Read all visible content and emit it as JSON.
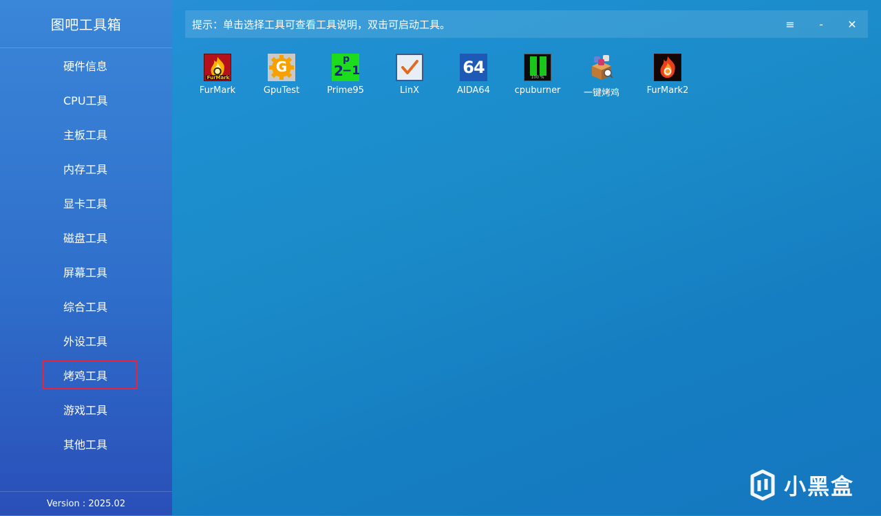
{
  "app": {
    "title": "图吧工具箱",
    "version": "Version : 2025.02"
  },
  "sidebar": {
    "items": [
      {
        "label": "硬件信息"
      },
      {
        "label": "CPU工具"
      },
      {
        "label": "主板工具"
      },
      {
        "label": "内存工具"
      },
      {
        "label": "显卡工具"
      },
      {
        "label": "磁盘工具"
      },
      {
        "label": "屏幕工具"
      },
      {
        "label": "综合工具"
      },
      {
        "label": "外设工具"
      },
      {
        "label": "烤鸡工具",
        "selected": true
      },
      {
        "label": "游戏工具"
      },
      {
        "label": "其他工具"
      }
    ]
  },
  "tip": {
    "text": "提示：单击选择工具可查看工具说明，双击可启动工具。"
  },
  "window_controls": {
    "menu": "≡",
    "minimize": "-",
    "close": "✕"
  },
  "tools": [
    {
      "label": "FurMark",
      "icon": "furmark-icon"
    },
    {
      "label": "GpuTest",
      "icon": "gputest-icon"
    },
    {
      "label": "Prime95",
      "icon": "prime95-icon"
    },
    {
      "label": "LinX",
      "icon": "linx-icon"
    },
    {
      "label": "AIDA64",
      "icon": "aida64-icon"
    },
    {
      "label": "cpuburner",
      "icon": "cpuburner-icon"
    },
    {
      "label": "一键烤鸡",
      "icon": "one-click-stress-icon"
    },
    {
      "label": "FurMark2",
      "icon": "furmark2-icon"
    }
  ],
  "icon_text": {
    "furmark_logo": "FurMark",
    "prime95_exp": "p",
    "prime95_base": "2",
    "prime95_minus": "−1",
    "aida64": "64",
    "gputest": "G",
    "cpuburner": "100 %"
  },
  "watermark": {
    "text": "小黑盒"
  },
  "colors": {
    "accent_selected_border": "#e8233a",
    "sidebar_top": "#3a86d8",
    "sidebar_bottom": "#2a4fb8",
    "main_bg": "#1b8bc8"
  }
}
